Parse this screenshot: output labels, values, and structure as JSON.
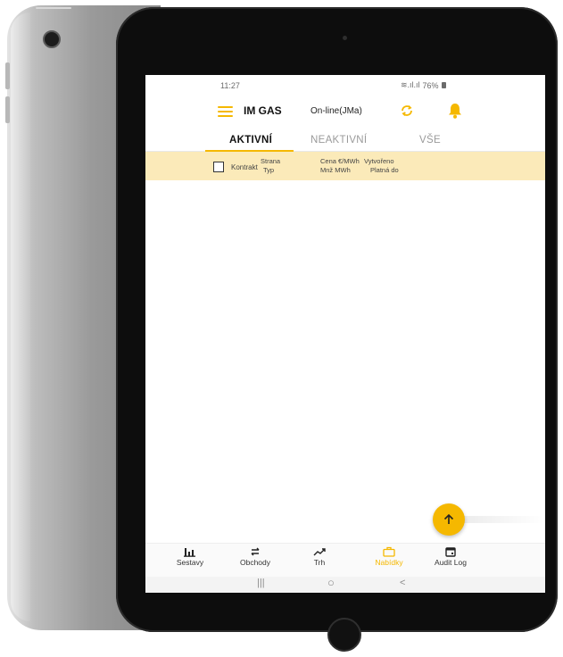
{
  "status_bar": {
    "time": "11:27",
    "signal": "≋.ıl.ıl",
    "battery": "76%"
  },
  "app_bar": {
    "title": "IM GAS",
    "connection": "On-line(JMa)"
  },
  "tabs": [
    {
      "label": "AKTIVNÍ",
      "active": true
    },
    {
      "label": "NEAKTIVNÍ",
      "active": false
    },
    {
      "label": "VŠE",
      "active": false
    }
  ],
  "table_header": {
    "contract": "Kontrakt",
    "side": "Strana",
    "type": "Typ",
    "price": "Cena €/MWh",
    "quantity": "Mnž MWh",
    "created": "Vytvořeno",
    "valid_until": "Platná do"
  },
  "bottom_nav": [
    {
      "label": "Sestavy",
      "icon": "bar-chart-icon",
      "active": false
    },
    {
      "label": "Obchody",
      "icon": "swap-arrows-icon",
      "active": false
    },
    {
      "label": "Trh",
      "icon": "trending-up-icon",
      "active": false
    },
    {
      "label": "Nabídky",
      "icon": "briefcase-icon",
      "active": true
    },
    {
      "label": "Audit Log",
      "icon": "calendar-icon",
      "active": false
    }
  ],
  "system_nav": {
    "recents": "|||",
    "home": "○",
    "back": "<"
  },
  "colors": {
    "accent": "#f5b800",
    "header_row": "#fbeab9"
  }
}
